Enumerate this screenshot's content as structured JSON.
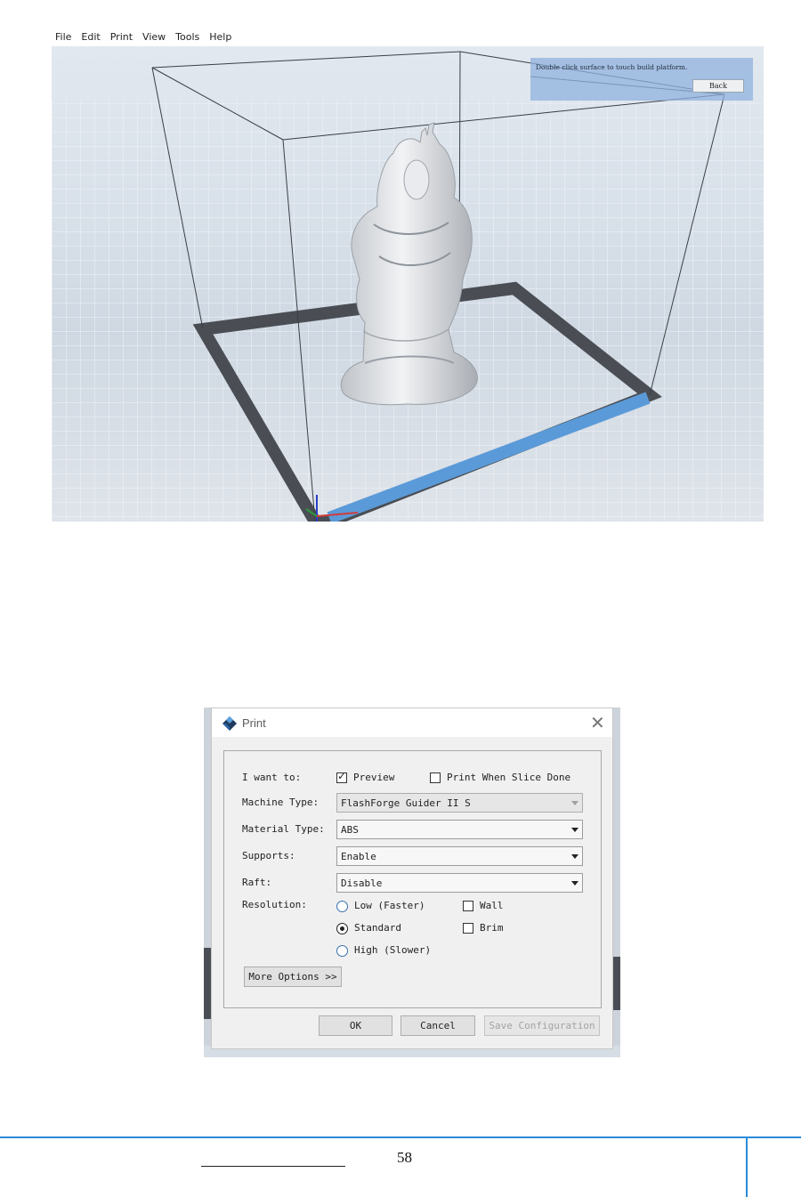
{
  "app_window": {
    "menu": [
      "File",
      "Edit",
      "Print",
      "View",
      "Tools",
      "Help"
    ],
    "hint_text": "Double click surface to touch build platform.",
    "back_button": "Back"
  },
  "print_dialog": {
    "title": "Print",
    "close_glyph": "✕",
    "i_want_to_label": "I want to:",
    "preview_label": "Preview",
    "preview_checked": true,
    "print_when_done_label": "Print When Slice Done",
    "print_when_done_checked": false,
    "machine_type_label": "Machine Type:",
    "machine_type_value": "FlashForge Guider II S",
    "material_type_label": "Material Type:",
    "material_type_value": "ABS",
    "supports_label": "Supports:",
    "supports_value": "Enable",
    "raft_label": "Raft:",
    "raft_value": "Disable",
    "resolution_label": "Resolution:",
    "resolution_options": [
      "Low (Faster)",
      "Standard",
      "High (Slower)"
    ],
    "resolution_selected": "Standard",
    "wall_label": "Wall",
    "brim_label": "Brim",
    "more_options_label": "More Options >>",
    "ok_label": "OK",
    "cancel_label": "Cancel",
    "save_config_label": "Save Configuration"
  },
  "footer": {
    "page_number": "58"
  },
  "colors": {
    "accent_blue": "#2a8bd8",
    "platform_blue": "#5b9ad8",
    "platform_edge": "#4a4e54"
  }
}
